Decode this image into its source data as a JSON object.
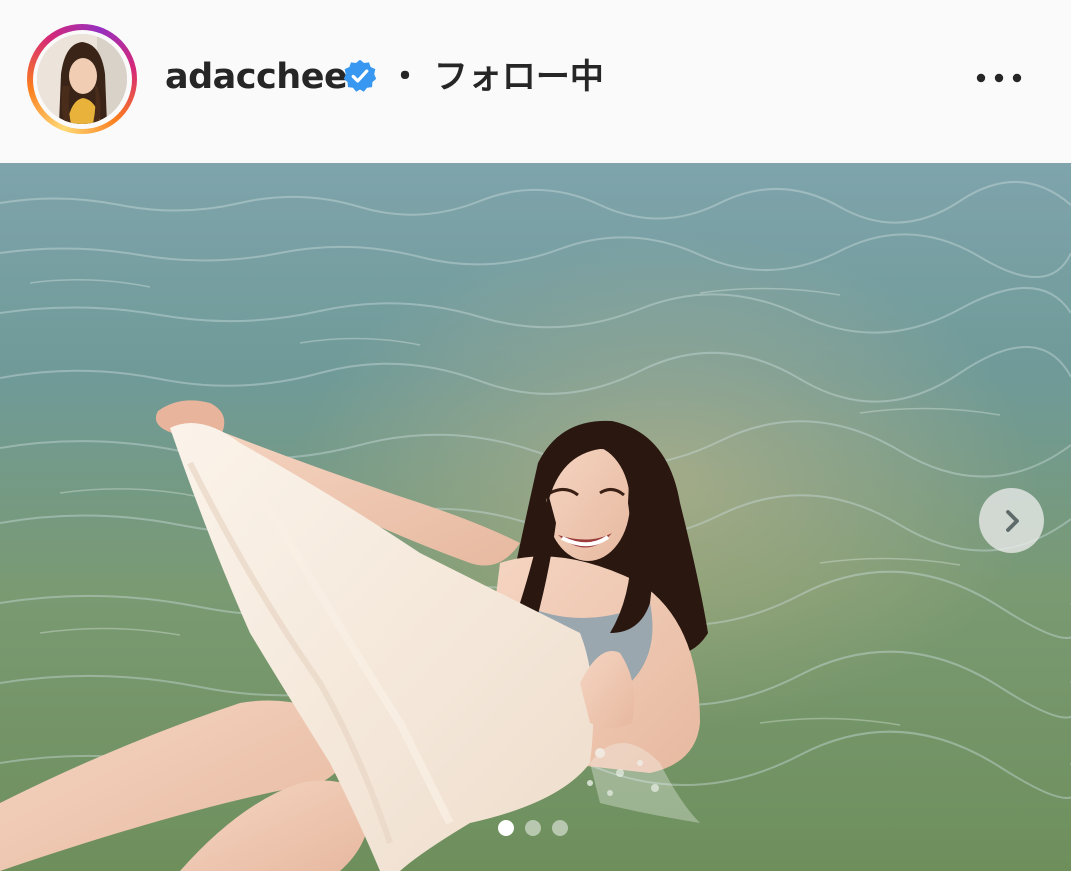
{
  "post": {
    "username": "adacchee",
    "verified": true,
    "follow_status": "・ フォロー中",
    "more_icon": "more-horizontal-icon",
    "verified_icon": "verified-badge-icon",
    "accent_verified": "#3897f0"
  },
  "media": {
    "slide_count": 3,
    "active_slide": 1,
    "next_icon": "chevron-right-icon"
  }
}
